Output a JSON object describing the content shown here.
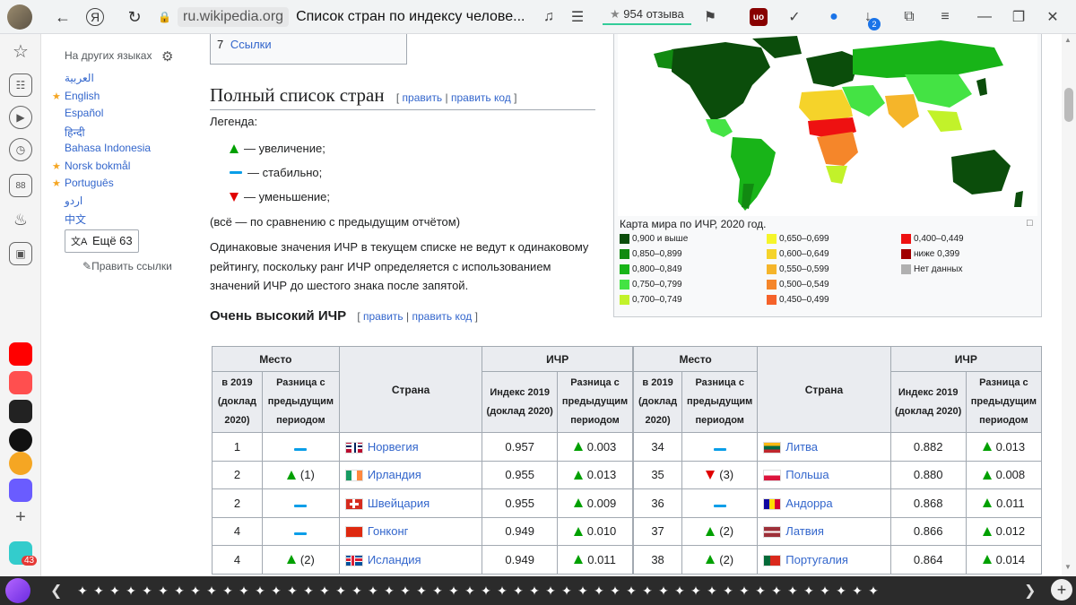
{
  "browser": {
    "tab_host": "ru.wikipedia.org",
    "tab_title": "Список стран по индексу челове...",
    "reviews": "954 отзыва",
    "downloads_badge": "2",
    "sidebar_badge": "43",
    "sidebar_counter": "88"
  },
  "wiki_panel": {
    "heading": "На других языках",
    "languages": [
      {
        "label": "العربية",
        "featured": false
      },
      {
        "label": "English",
        "featured": true
      },
      {
        "label": "Español",
        "featured": false
      },
      {
        "label": "हिन्दी",
        "featured": false
      },
      {
        "label": "Bahasa Indonesia",
        "featured": false
      },
      {
        "label": "Norsk bokmål",
        "featured": true
      },
      {
        "label": "Português",
        "featured": true
      },
      {
        "label": "اردو",
        "featured": false
      },
      {
        "label": "中文",
        "featured": false
      }
    ],
    "more_button": "Ещё 63",
    "edit_links": "Править ссылки"
  },
  "article": {
    "toc_item_number": "7",
    "toc_item_label": "Ссылки",
    "section_title": "Полный список стран",
    "edit": "править",
    "edit_code": "править код",
    "legend_label": "Легенда:",
    "legend_up": "— увеличение;",
    "legend_same": "— стабильно;",
    "legend_down": "— уменьшение;",
    "legend_note": "(всё — по сравнению с предыдущим отчётом)",
    "para_line1": "Одинаковые значения ИЧР в текущем списке не ведут к одинаковому",
    "para_line2": "рейтингу, поскольку ранг ИЧР определяется с использованием",
    "para_line3": "значений ИЧР до шестого знака после запятой.",
    "subsection_title": "Очень высокий ИЧР"
  },
  "map": {
    "caption": "Карта мира по ИЧР, 2020 год.",
    "legend": [
      {
        "label": "0,900 и выше",
        "color": "#0b4d0b"
      },
      {
        "label": "0,850–0,899",
        "color": "#118a11"
      },
      {
        "label": "0,800–0,849",
        "color": "#18b418"
      },
      {
        "label": "0,750–0,799",
        "color": "#44e344"
      },
      {
        "label": "0,700–0,749",
        "color": "#c2f22a"
      },
      {
        "label": "0,650–0,699",
        "color": "#f5f52a"
      },
      {
        "label": "0,600–0,649",
        "color": "#f5d32a"
      },
      {
        "label": "0,550–0,599",
        "color": "#f5b52a"
      },
      {
        "label": "0,500–0,549",
        "color": "#f5862a"
      },
      {
        "label": "0,450–0,499",
        "color": "#f5622a"
      },
      {
        "label": "0,400–0,449",
        "color": "#ee1111"
      },
      {
        "label": "ниже 0,399",
        "color": "#a00000"
      },
      {
        "label": "Нет данных",
        "color": "#b0b0b0"
      }
    ]
  },
  "table": {
    "h_place": "Место",
    "h_hdi": "ИЧР",
    "h_country": "Страна",
    "h_2019": "в 2019 (доклад 2020)",
    "h_diff": "Разница с предыдущим периодом",
    "h_index": "Индекс 2019 (доклад 2020)",
    "h_diff2": "Разница с предыдущим периодом",
    "left_rows": [
      {
        "rank": "1",
        "rank_change": "same",
        "rank_change_text": "",
        "country": "Норвегия",
        "flag": "no",
        "index": "0.957",
        "index_change": "0.003"
      },
      {
        "rank": "2",
        "rank_change": "up",
        "rank_change_text": "(1)",
        "country": "Ирландия",
        "flag": "ie",
        "index": "0.955",
        "index_change": "0.013"
      },
      {
        "rank": "2",
        "rank_change": "same",
        "rank_change_text": "",
        "country": "Швейцария",
        "flag": "ch",
        "index": "0.955",
        "index_change": "0.009"
      },
      {
        "rank": "4",
        "rank_change": "same",
        "rank_change_text": "",
        "country": "Гонконг",
        "flag": "hk",
        "index": "0.949",
        "index_change": "0.010"
      },
      {
        "rank": "4",
        "rank_change": "up",
        "rank_change_text": "(2)",
        "country": "Исландия",
        "flag": "is",
        "index": "0.949",
        "index_change": "0.011"
      }
    ],
    "right_rows": [
      {
        "rank": "34",
        "rank_change": "same",
        "rank_change_text": "",
        "country": "Литва",
        "flag": "lt",
        "index": "0.882",
        "index_change": "0.013"
      },
      {
        "rank": "35",
        "rank_change": "down",
        "rank_change_text": "(3)",
        "country": "Польша",
        "flag": "pl",
        "index": "0.880",
        "index_change": "0.008"
      },
      {
        "rank": "36",
        "rank_change": "same",
        "rank_change_text": "",
        "country": "Андорра",
        "flag": "ad",
        "index": "0.868",
        "index_change": "0.011"
      },
      {
        "rank": "37",
        "rank_change": "up",
        "rank_change_text": "(2)",
        "country": "Латвия",
        "flag": "lv",
        "index": "0.866",
        "index_change": "0.012"
      },
      {
        "rank": "38",
        "rank_change": "up",
        "rank_change_text": "(2)",
        "country": "Португалия",
        "flag": "pt",
        "index": "0.864",
        "index_change": "0.014"
      }
    ]
  }
}
